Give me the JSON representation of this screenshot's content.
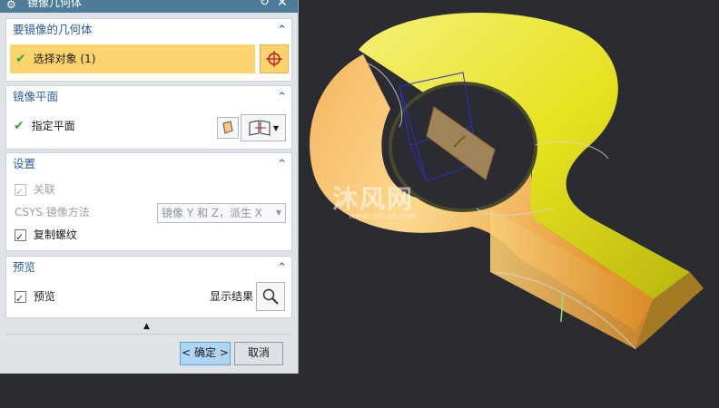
{
  "dialog": {
    "title": "镜像几何体",
    "sections": {
      "geometry": {
        "header": "要镜像的几何体",
        "select_label": "选择对象 (1)"
      },
      "plane": {
        "header": "镜像平面",
        "specify_label": "指定平面"
      },
      "settings": {
        "header": "设置",
        "associative_label": "关联",
        "csys_label": "CSYS 镜像方法",
        "csys_value": "镜像 Y 和 Z，派生 X",
        "copy_threads_label": "复制螺纹"
      },
      "preview": {
        "header": "预览",
        "preview_label": "预览",
        "show_result_label": "显示结果"
      }
    },
    "ok_label": "< 确定 >",
    "cancel_label": "取消"
  },
  "watermark": {
    "brand": "沐风网",
    "url": "www.mfcad.com"
  },
  "colors": {
    "title_bar": "#4d7c98",
    "section_header": "#2a5d9e",
    "select_highlight": "#fbd46d",
    "ok_button": "#aed6f3",
    "viewport_bg": "#2b2c31"
  },
  "icons": [
    "gear-icon",
    "reset-icon",
    "close-icon",
    "chevron-up-icon",
    "checkmark-icon",
    "crosshair-icon",
    "plane-icon",
    "plane-dialog-icon",
    "dropdown-arrow-icon",
    "magnifier-icon",
    "collapse-arrow-icon"
  ]
}
